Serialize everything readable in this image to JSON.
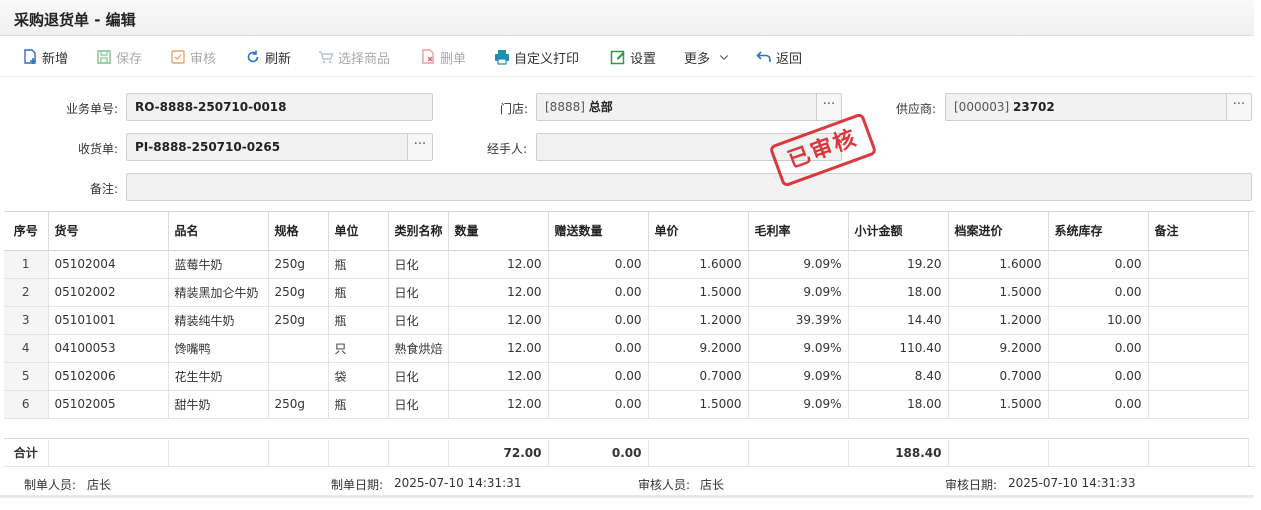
{
  "window": {
    "title": "采购退货单 - 编辑"
  },
  "toolbar": {
    "add": "新增",
    "save": "保存",
    "audit": "审核",
    "refresh": "刷新",
    "select_goods": "选择商品",
    "delete": "删单",
    "custom_print": "自定义打印",
    "settings": "设置",
    "more": "更多",
    "back": "返回"
  },
  "form": {
    "order_no_label": "业务单号:",
    "order_no": "RO-8888-250710-0018",
    "store_label": "门店:",
    "store_code": "[8888]",
    "store_name": "总部",
    "supplier_label": "供应商:",
    "supplier_code": "[000003]",
    "supplier_name": "23702",
    "receipt_label": "收货单:",
    "receipt_no": "PI-8888-250710-0265",
    "handler_label": "经手人:",
    "handler": "",
    "remark_label": "备注:",
    "remark": "",
    "ellipsis": "···"
  },
  "stamp": {
    "text": "已审核",
    "color": "#d9242b"
  },
  "table": {
    "columns": [
      "序号",
      "货号",
      "品名",
      "规格",
      "单位",
      "类别名称",
      "数量",
      "赠送数量",
      "单价",
      "毛利率",
      "小计金额",
      "档案进价",
      "系统库存",
      "备注"
    ],
    "rows": [
      [
        "1",
        "05102004",
        "蓝莓牛奶",
        "250g",
        "瓶",
        "日化",
        "12.00",
        "0.00",
        "1.6000",
        "9.09%",
        "19.20",
        "1.6000",
        "0.00",
        ""
      ],
      [
        "2",
        "05102002",
        "精装黑加仑牛奶",
        "250g",
        "瓶",
        "日化",
        "12.00",
        "0.00",
        "1.5000",
        "9.09%",
        "18.00",
        "1.5000",
        "0.00",
        ""
      ],
      [
        "3",
        "05101001",
        "精装纯牛奶",
        "250g",
        "瓶",
        "日化",
        "12.00",
        "0.00",
        "1.2000",
        "39.39%",
        "14.40",
        "1.2000",
        "10.00",
        ""
      ],
      [
        "4",
        "04100053",
        "馋嘴鸭",
        "",
        "只",
        "熟食烘焙",
        "12.00",
        "0.00",
        "9.2000",
        "9.09%",
        "110.40",
        "9.2000",
        "0.00",
        ""
      ],
      [
        "5",
        "05102006",
        "花生牛奶",
        "",
        "袋",
        "日化",
        "12.00",
        "0.00",
        "0.7000",
        "9.09%",
        "8.40",
        "0.7000",
        "0.00",
        ""
      ],
      [
        "6",
        "05102005",
        "甜牛奶",
        "250g",
        "瓶",
        "日化",
        "12.00",
        "0.00",
        "1.5000",
        "9.09%",
        "18.00",
        "1.5000",
        "0.00",
        ""
      ]
    ],
    "total_label": "合计",
    "total_qty": "72.00",
    "total_gift": "0.00",
    "total_amount": "188.40"
  },
  "footer": {
    "creator_label": "制单人员:",
    "creator": "店长",
    "created_label": "制单日期:",
    "created": "2025-07-10 14:31:31",
    "auditor_label": "审核人员:",
    "auditor": "店长",
    "audited_label": "审核日期:",
    "audited": "2025-07-10 14:31:33"
  },
  "colors": {
    "accent": "#2e6fc7",
    "green": "#2e9a4a",
    "orange": "#e07b24",
    "red": "#d9242b"
  }
}
